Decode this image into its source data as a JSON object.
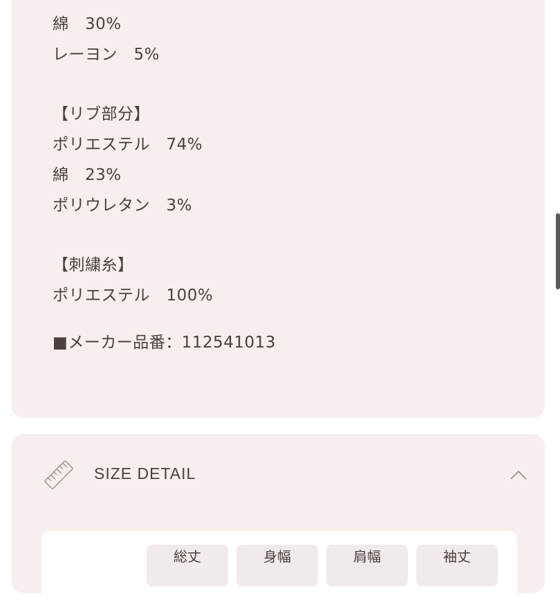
{
  "material": {
    "lines": [
      "綿　30%",
      "レーヨン　5%",
      "【リブ部分】",
      "ポリエステル　74%",
      "綿　23%",
      "ポリウレタン　3%",
      "【刺繍糸】",
      "ポリエステル　100%",
      "■メーカー品番：112541013"
    ]
  },
  "size_detail": {
    "title": "SIZE DETAIL",
    "columns": [
      "総丈",
      "身幅",
      "肩幅",
      "袖丈"
    ]
  },
  "icons": {
    "ruler": "ruler-icon",
    "collapse": "chevron-up-icon"
  },
  "colors": {
    "card_bg": "#f6efed",
    "text": "#4a3f3b",
    "cell_bg": "#f1eaea"
  }
}
